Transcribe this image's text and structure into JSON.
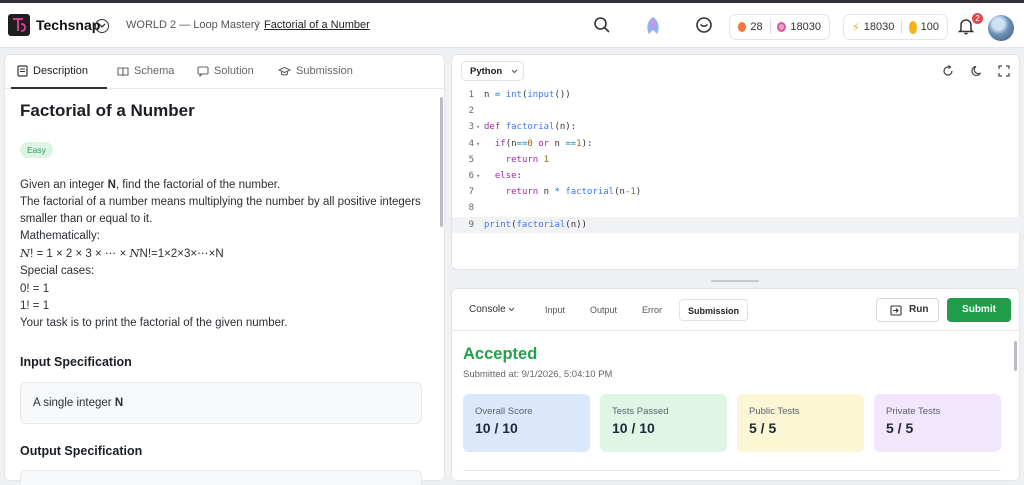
{
  "header": {
    "brand": "Techsnap",
    "breadcrumb_world": "WORLD 2 — Loop Mastery",
    "breadcrumb_problem": "Factorial of a Number",
    "streak_count": "28",
    "xp_count": "18030",
    "energy_count": "18030",
    "coin_count": "100",
    "notification_count": "2"
  },
  "left_tabs": [
    "Description",
    "Schema",
    "Solution",
    "Submission"
  ],
  "problem": {
    "title": "Factorial of a Number",
    "difficulty": "Easy",
    "intro_pre": "Given an integer ",
    "intro_var": "N",
    "intro_post": ", find the factorial of the number.",
    "line2": "The factorial of a number means multiplying the number by all positive integers smaller than or equal to it.",
    "line3": "Mathematically:",
    "math_a": "N",
    "math_b": "! = 1 × 2 × 3 ×  ⋯  × ",
    "math_c": "N",
    "math_d": "N!=1×2×3×⋯×N",
    "special": "Special cases:",
    "case0": "0! = 1",
    "case1": "1! = 1",
    "task": "Your task is to print the factorial of the given number.",
    "input_heading": "Input Specification",
    "input_spec_pre": "A single integer ",
    "input_spec_var": "N",
    "output_heading": "Output Specification"
  },
  "editor": {
    "language": "Python",
    "line_numbers": [
      "1",
      "2",
      "3",
      "4",
      "5",
      "6",
      "7",
      "8",
      "9"
    ],
    "lines": [
      "n = int(input())",
      "",
      "def factorial(n):",
      "  if(n==0 or n ==1):",
      "    return 1",
      "  else:",
      "    return n * factorial(n-1)",
      "",
      "print(factorial(n))"
    ]
  },
  "console": {
    "tabs": [
      "Console",
      "Input",
      "Output",
      "Error",
      "Submission"
    ],
    "run_label": "Run",
    "submit_label": "Submit",
    "status": "Accepted",
    "submitted_at": "Submitted at: 9/1/2026, 5:04:10 PM",
    "cards": [
      {
        "label": "Overall Score",
        "value": "10 / 10",
        "color": "#dbe8fb"
      },
      {
        "label": "Tests Passed",
        "value": "10 / 10",
        "color": "#dff6e6"
      },
      {
        "label": "Public Tests",
        "value": "5 / 5",
        "color": "#fbf6d3"
      },
      {
        "label": "Private Tests",
        "value": "5 / 5",
        "color": "#f1e6fb"
      }
    ]
  },
  "colors": {
    "accent_green": "#1f9d4a",
    "accepted_green": "#21a24b",
    "easy_bg": "#ddf3e4"
  }
}
